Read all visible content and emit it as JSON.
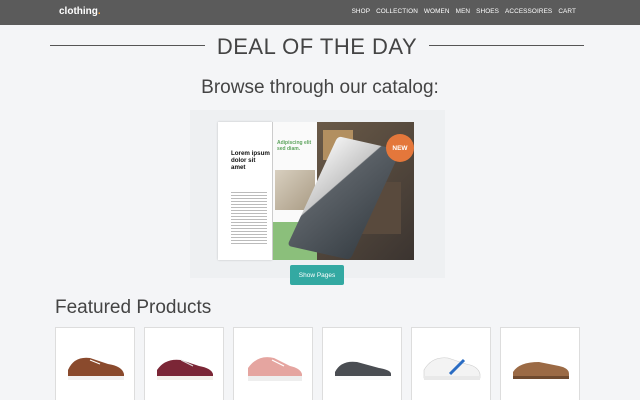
{
  "brand": {
    "name": "clothing",
    "dot": "."
  },
  "nav": [
    {
      "label": "SHOP"
    },
    {
      "label": "COLLECTION"
    },
    {
      "label": "WOMEN"
    },
    {
      "label": "MEN"
    },
    {
      "label": "SHOES"
    },
    {
      "label": "ACCESSOIRES"
    },
    {
      "label": "CART"
    }
  ],
  "deal": {
    "title": "DEAL OF THE DAY"
  },
  "catalog": {
    "heading": "Browse through our catalog:",
    "left_heading": "Lorem ipsum dolor sit amet",
    "mid_heading": "Adipiscing elit sed diam.",
    "badge": "NEW",
    "button_label": "Show Pages"
  },
  "featured": {
    "title": "Featured Products",
    "products": [
      {
        "icon": "sneaker-brown-icon",
        "color": "#8a4a2d"
      },
      {
        "icon": "sneaker-maroon-icon",
        "color": "#7b2636"
      },
      {
        "icon": "sneaker-pink-icon",
        "color": "#e5a5a0"
      },
      {
        "icon": "sneaker-gray-icon",
        "color": "#4a4d52"
      },
      {
        "icon": "sneaker-white-blue-icon",
        "color": "#2a6cc3"
      },
      {
        "icon": "loafer-brown-icon",
        "color": "#9b6a45"
      }
    ]
  },
  "colors": {
    "nav_bg": "#5b5b5b",
    "accent": "#33a9a2",
    "badge": "#e4773b"
  }
}
